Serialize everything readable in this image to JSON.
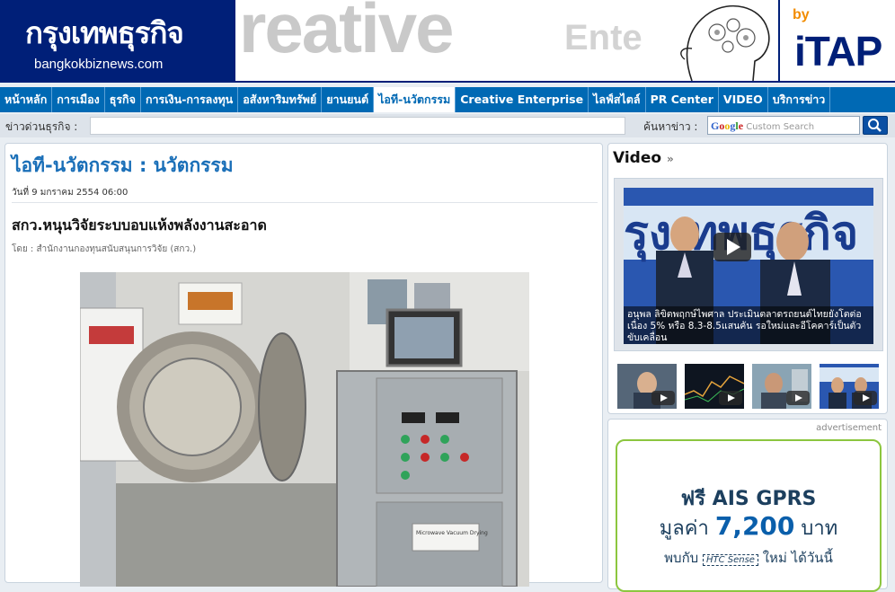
{
  "header": {
    "logo_thai": "กรุงเทพธุรกิจ",
    "logo_domain": "bangkokbiznews.com",
    "banner_word": "reative",
    "banner_word2": "Ente",
    "banner_by": "by",
    "banner_brand": "iTAP"
  },
  "nav": {
    "items": [
      {
        "label": "หน้าหลัก"
      },
      {
        "label": "การเมือง"
      },
      {
        "label": "ธุรกิจ"
      },
      {
        "label": "การเงิน-การลงทุน"
      },
      {
        "label": "อสังหาริมทรัพย์"
      },
      {
        "label": "ยานยนต์"
      },
      {
        "label": "ไอที-นวัตกรรม",
        "active": true
      },
      {
        "label": "Creative Enterprise"
      },
      {
        "label": "ไลฟ์สไตล์"
      },
      {
        "label": "PR Center"
      },
      {
        "label": "VIDEO"
      },
      {
        "label": "บริการข่าว"
      }
    ]
  },
  "newsbar": {
    "label": "ข่าวด่วนธุรกิจ :",
    "search_label": "ค้นหาข่าว :",
    "search_placeholder": "Custom Search",
    "google_letters": [
      "G",
      "o",
      "o",
      "g",
      "l",
      "e"
    ]
  },
  "article": {
    "section": "ไอที-นวัตกรรม : นวัตกรรม",
    "date": "วันที่ 9 มกราคม 2554 06:00",
    "headline": "สกว.หนุนวิจัยระบบอบแห้งพลังงานสะอาด",
    "byline": "โดย : สำนักงานกองทุนสนับสนุนการวิจัย (สกว.)",
    "photo_sign": "Microwave Vacuum Drying"
  },
  "video": {
    "title": "Video",
    "caption": "อนุพล ลิขิตพฤกษ์ไพศาล ประเมินตลาดรถยนต์ไทยยังโตต่อเนื่อง 5% หรือ 8.3-8.5แสนคัน รอใหม่และอีโคคาร์เป็นตัวขับเคลื่อน",
    "thumbs": [
      "thumb-1",
      "thumb-2",
      "thumb-3",
      "thumb-4"
    ]
  },
  "ad": {
    "label": "advertisement",
    "line1": "ฟรี AIS GPRS",
    "line2_prefix": "มูลค่า",
    "line2_amount": "7,200",
    "line2_suffix": "บาท",
    "line3_prefix": "พบกับ",
    "line3_brand": "HTC Sense",
    "line3_suffix": "ใหม่ ได้วันนี้"
  },
  "colors": {
    "brand_navy": "#001f78",
    "nav_blue": "#0069b4",
    "section_blue": "#1a6fb8",
    "ad_green": "#8cc63f"
  }
}
